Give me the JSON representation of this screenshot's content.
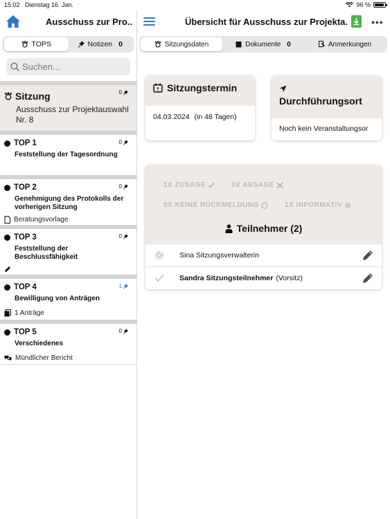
{
  "status_bar": {
    "time": "15:02",
    "date": "Dienstag 16. Jan.",
    "battery": "96 %"
  },
  "sidebar": {
    "title": "Ausschuss zur Pro...",
    "tabs": [
      {
        "label": "TOPS",
        "active": true
      },
      {
        "label": "Notizen",
        "count": "0",
        "active": false
      }
    ],
    "search_placeholder": "Suchen...",
    "sitzung": {
      "title": "Sitzung",
      "subtitle": "Ausschuss zur Projektauswahl Nr. 8",
      "pins": "0"
    },
    "tops": [
      {
        "number": "TOP 1",
        "title": "Feststellung der Tagesordnung",
        "pins": "0",
        "meta": "",
        "meta_icon": ""
      },
      {
        "number": "TOP 2",
        "title": "Genehmigung des Protokolls der vorherigen Sitzung",
        "pins": "0",
        "meta": "Beratungsvorlage",
        "meta_icon": "document-icon"
      },
      {
        "number": "TOP 3",
        "title": "Feststellung der Beschlussfähigkeit",
        "pins": "0",
        "meta": "",
        "meta_icon": "pencil-icon"
      },
      {
        "number": "TOP 4",
        "title": "Bewilligung von Anträgen",
        "pins": "1",
        "meta": "1 Anträge",
        "meta_icon": "documents-icon"
      },
      {
        "number": "TOP 5",
        "title": "Verschiedenes",
        "pins": "0",
        "meta": "Mündlicher Bericht",
        "meta_icon": "chat-icon"
      }
    ]
  },
  "main": {
    "title": "Übersicht für Ausschuss zur Projekta...",
    "tabs": [
      {
        "label": "Sitzungsdaten",
        "active": true
      },
      {
        "label": "Dokumente",
        "count": "0",
        "active": false
      },
      {
        "label": "Anmerkungen",
        "active": false
      }
    ],
    "termin": {
      "title": "Sitzungstermin",
      "date": "04.03.2024",
      "relative": "(in 48 Tagen)"
    },
    "ort": {
      "title": "Durchführungsort",
      "value": "Noch kein Veranstaltungsor"
    },
    "participants": {
      "stats": {
        "zusage": "1X ZUSAGE",
        "absage": "0X ABSAGE",
        "keine": "0X KEINE RÜCKMELDUNG",
        "informativ": "1X INFORMATIV"
      },
      "title": "Teilnehmer (2)",
      "rows": [
        {
          "name": "Sina Sitzungsverwalterin",
          "role": "",
          "icon": "gear-icon"
        },
        {
          "name": "Sandra Sitzungsteilnehmer",
          "role": "(Vorsitz)",
          "icon": "check-icon"
        }
      ]
    }
  },
  "colors": {
    "accent": "#2f78c8",
    "card_head": "#edeae7",
    "download": "#4db34b"
  }
}
